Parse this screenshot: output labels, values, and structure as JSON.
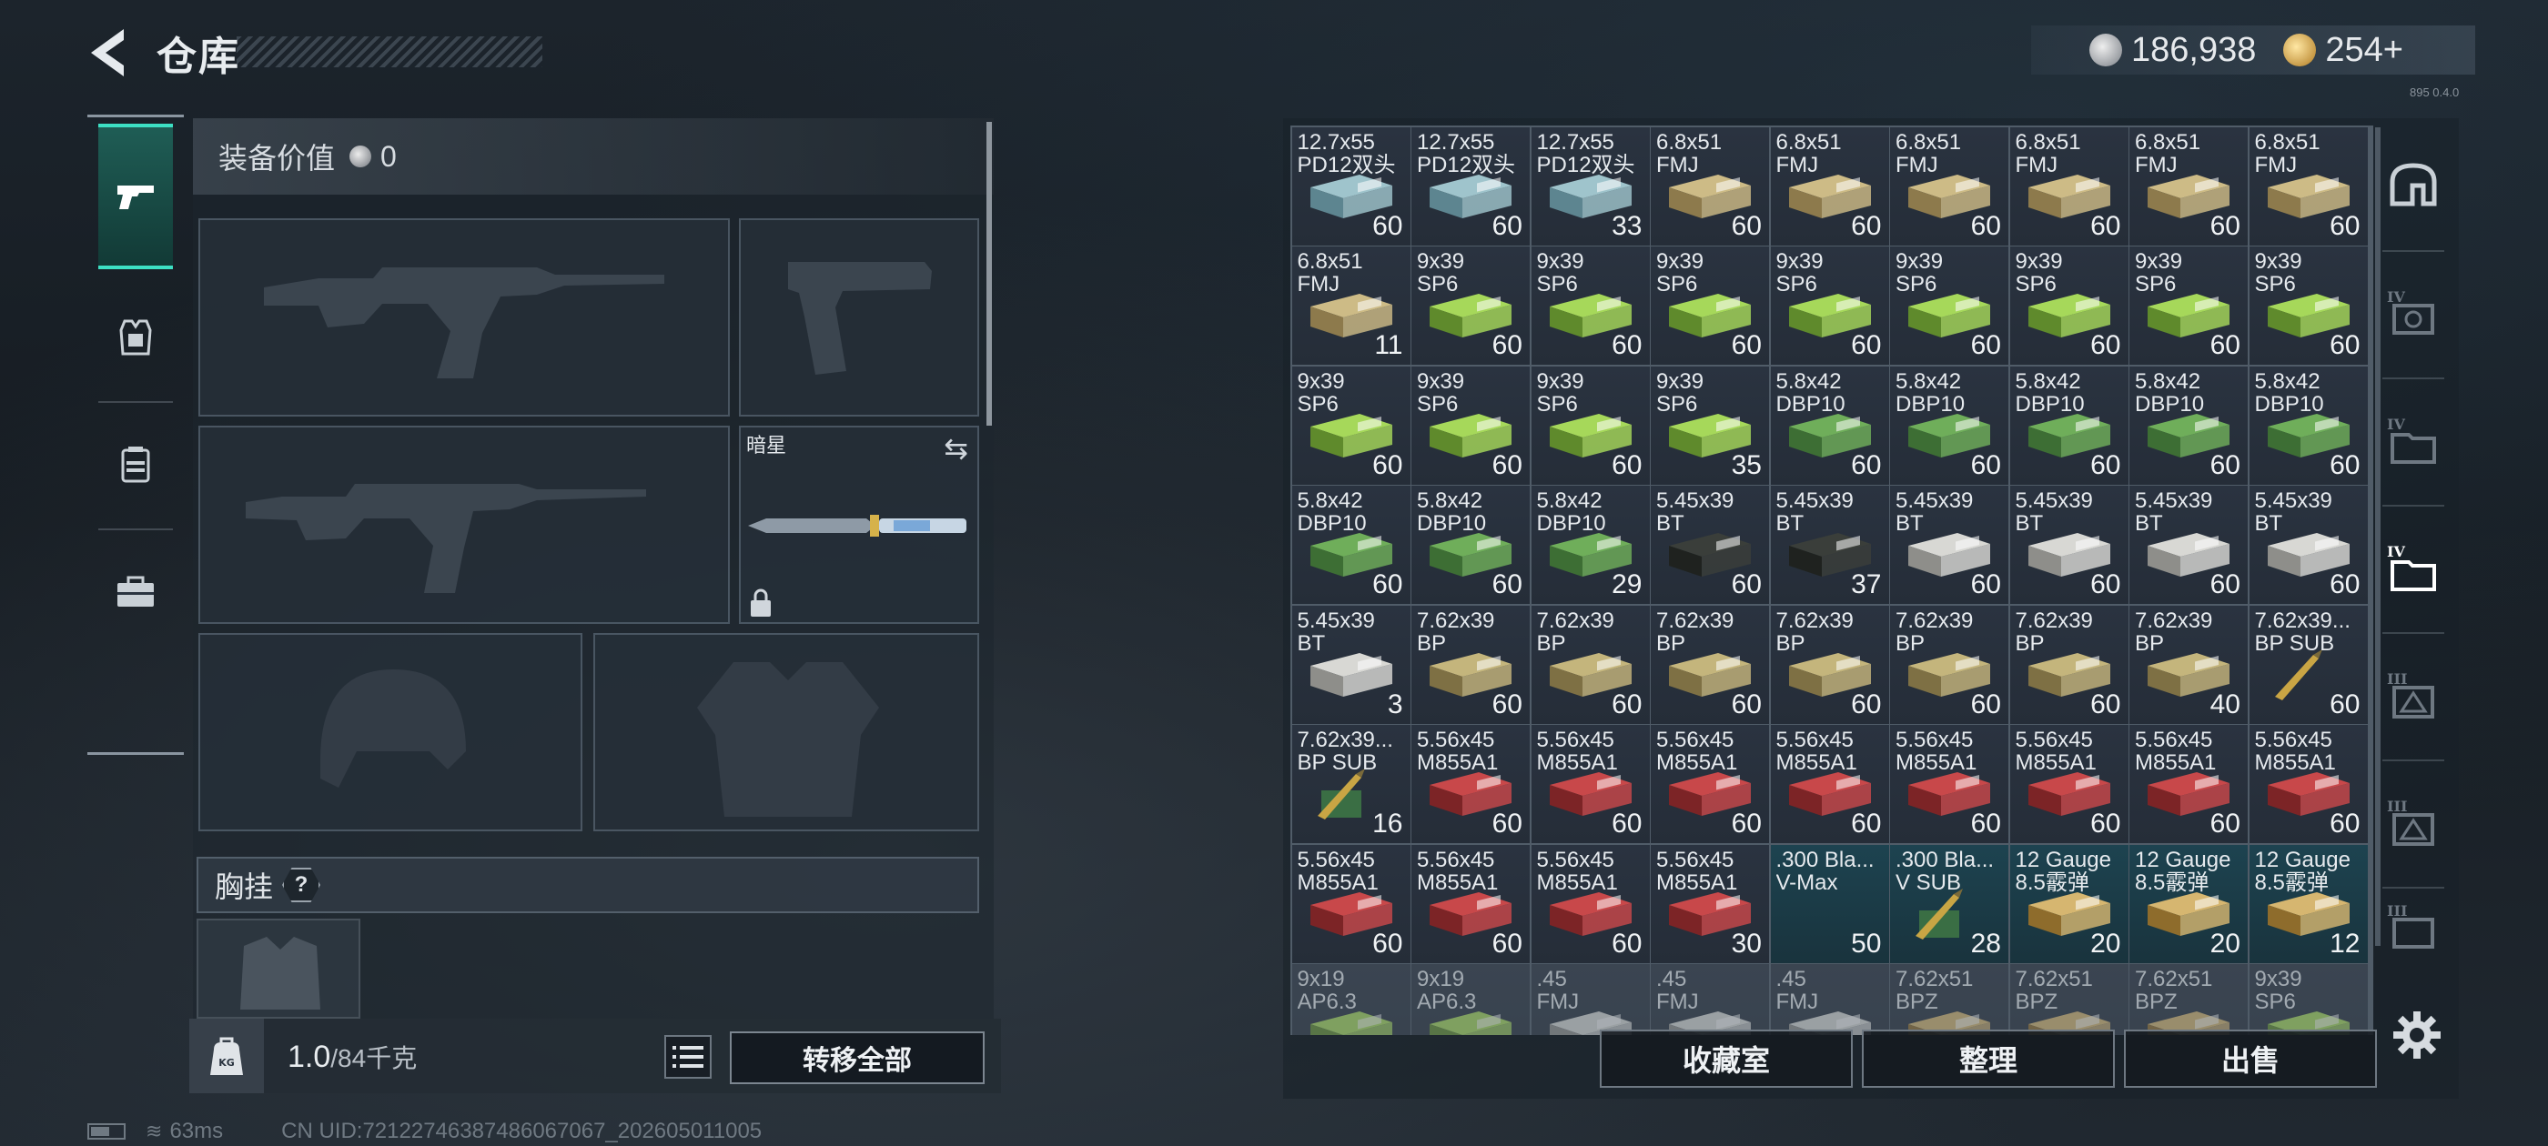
{
  "header": {
    "title": "仓库",
    "currency": {
      "silver": "186,938",
      "gold": "254+"
    },
    "version": "895 0.4.0"
  },
  "loadout": {
    "value_label": "装备价值",
    "value": "0",
    "melee_name": "暗星",
    "chest_rig_label": "胸挂",
    "chest_rig_help": "?",
    "weight_current": "1.0",
    "weight_max": "/84千克",
    "transfer_all": "转移全部"
  },
  "stash": {
    "items": [
      {
        "name": "12.7x55\nPD12双头",
        "count": "60",
        "box": "blue"
      },
      {
        "name": "12.7x55\nPD12双头",
        "count": "60",
        "box": "blue"
      },
      {
        "name": "12.7x55\nPD12双头",
        "count": "33",
        "box": "blue"
      },
      {
        "name": "6.8x51\nFMJ",
        "count": "60",
        "box": "tan"
      },
      {
        "name": "6.8x51\nFMJ",
        "count": "60",
        "box": "tan"
      },
      {
        "name": "6.8x51\nFMJ",
        "count": "60",
        "box": "tan"
      },
      {
        "name": "6.8x51\nFMJ",
        "count": "60",
        "box": "tan"
      },
      {
        "name": "6.8x51\nFMJ",
        "count": "60",
        "box": "tan"
      },
      {
        "name": "6.8x51\nFMJ",
        "count": "60",
        "box": "tan"
      },
      {
        "name": "6.8x51\nFMJ",
        "count": "11",
        "box": "tan"
      },
      {
        "name": "9x39\nSP6",
        "count": "60",
        "box": "lime"
      },
      {
        "name": "9x39\nSP6",
        "count": "60",
        "box": "lime"
      },
      {
        "name": "9x39\nSP6",
        "count": "60",
        "box": "lime"
      },
      {
        "name": "9x39\nSP6",
        "count": "60",
        "box": "lime"
      },
      {
        "name": "9x39\nSP6",
        "count": "60",
        "box": "lime"
      },
      {
        "name": "9x39\nSP6",
        "count": "60",
        "box": "lime"
      },
      {
        "name": "9x39\nSP6",
        "count": "60",
        "box": "lime"
      },
      {
        "name": "9x39\nSP6",
        "count": "60",
        "box": "lime"
      },
      {
        "name": "9x39\nSP6",
        "count": "60",
        "box": "lime"
      },
      {
        "name": "9x39\nSP6",
        "count": "60",
        "box": "lime"
      },
      {
        "name": "9x39\nSP6",
        "count": "60",
        "box": "lime"
      },
      {
        "name": "9x39\nSP6",
        "count": "35",
        "box": "lime"
      },
      {
        "name": "5.8x42\nDBP10",
        "count": "60",
        "box": "green"
      },
      {
        "name": "5.8x42\nDBP10",
        "count": "60",
        "box": "green"
      },
      {
        "name": "5.8x42\nDBP10",
        "count": "60",
        "box": "green"
      },
      {
        "name": "5.8x42\nDBP10",
        "count": "60",
        "box": "green"
      },
      {
        "name": "5.8x42\nDBP10",
        "count": "60",
        "box": "green"
      },
      {
        "name": "5.8x42\nDBP10",
        "count": "60",
        "box": "green"
      },
      {
        "name": "5.8x42\nDBP10",
        "count": "60",
        "box": "green"
      },
      {
        "name": "5.8x42\nDBP10",
        "count": "29",
        "box": "green"
      },
      {
        "name": "5.45x39\nBT",
        "count": "60",
        "box": "dark"
      },
      {
        "name": "5.45x39\nBT",
        "count": "37",
        "box": "dark"
      },
      {
        "name": "5.45x39\nBT",
        "count": "60",
        "box": "white"
      },
      {
        "name": "5.45x39\nBT",
        "count": "60",
        "box": "white"
      },
      {
        "name": "5.45x39\nBT",
        "count": "60",
        "box": "white"
      },
      {
        "name": "5.45x39\nBT",
        "count": "60",
        "box": "white"
      },
      {
        "name": "5.45x39\nBT",
        "count": "3",
        "box": "white"
      },
      {
        "name": "7.62x39\nBP",
        "count": "60",
        "box": "khaki"
      },
      {
        "name": "7.62x39\nBP",
        "count": "60",
        "box": "khaki"
      },
      {
        "name": "7.62x39\nBP",
        "count": "60",
        "box": "khaki"
      },
      {
        "name": "7.62x39\nBP",
        "count": "60",
        "box": "khaki"
      },
      {
        "name": "7.62x39\nBP",
        "count": "60",
        "box": "khaki"
      },
      {
        "name": "7.62x39\nBP",
        "count": "60",
        "box": "khaki"
      },
      {
        "name": "7.62x39\nBP",
        "count": "40",
        "box": "khaki"
      },
      {
        "name": "7.62x39...\nBP SUB",
        "count": "60",
        "box": "bullet"
      },
      {
        "name": "7.62x39...\nBP SUB",
        "count": "16",
        "box": "bulletgreen"
      },
      {
        "name": "5.56x45\nM855A1",
        "count": "60",
        "box": "red"
      },
      {
        "name": "5.56x45\nM855A1",
        "count": "60",
        "box": "red"
      },
      {
        "name": "5.56x45\nM855A1",
        "count": "60",
        "box": "red"
      },
      {
        "name": "5.56x45\nM855A1",
        "count": "60",
        "box": "red"
      },
      {
        "name": "5.56x45\nM855A1",
        "count": "60",
        "box": "red"
      },
      {
        "name": "5.56x45\nM855A1",
        "count": "60",
        "box": "red"
      },
      {
        "name": "5.56x45\nM855A1",
        "count": "60",
        "box": "red"
      },
      {
        "name": "5.56x45\nM855A1",
        "count": "60",
        "box": "red"
      },
      {
        "name": "5.56x45\nM855A1",
        "count": "60",
        "box": "red"
      },
      {
        "name": "5.56x45\nM855A1",
        "count": "60",
        "box": "red"
      },
      {
        "name": "5.56x45\nM855A1",
        "count": "60",
        "box": "red"
      },
      {
        "name": "5.56x45\nM855A1",
        "count": "30",
        "box": "red"
      },
      {
        "name": ".300 Bla...\nV-Max",
        "count": "50",
        "box": "none",
        "teal": true
      },
      {
        "name": ".300 Bla...\nV SUB",
        "count": "28",
        "box": "bulletgreen",
        "teal": true
      },
      {
        "name": "12 Gauge\n8.5霰弹",
        "count": "20",
        "box": "gauge",
        "teal": true
      },
      {
        "name": "12 Gauge\n8.5霰弹",
        "count": "20",
        "box": "gauge",
        "teal": true
      },
      {
        "name": "12 Gauge\n8.5霰弹",
        "count": "12",
        "box": "gauge",
        "teal": true
      },
      {
        "name": "9x19\nAP6.3",
        "count": "",
        "box": "lime",
        "dim": true
      },
      {
        "name": "9x19\nAP6.3",
        "count": "",
        "box": "lime",
        "dim": true
      },
      {
        "name": ".45\nFMJ",
        "count": "",
        "box": "white",
        "dim": true
      },
      {
        "name": ".45\nFMJ",
        "count": "",
        "box": "white",
        "dim": true
      },
      {
        "name": ".45\nFMJ",
        "count": "",
        "box": "white",
        "dim": true
      },
      {
        "name": "7.62x51\nBPZ",
        "count": "",
        "box": "gauge",
        "dim": true
      },
      {
        "name": "7.62x51\nBPZ",
        "count": "",
        "box": "gauge",
        "dim": true
      },
      {
        "name": "7.62x51\nBPZ",
        "count": "",
        "box": "gauge",
        "dim": true
      },
      {
        "name": "9x39\nSP6",
        "count": "",
        "box": "lime",
        "dim": true
      }
    ],
    "buttons": {
      "collection": "收藏室",
      "sort": "整理",
      "sell": "出售"
    }
  },
  "status": {
    "ping": "63ms",
    "uid": "CN UID:72122746387486067067_202605011005"
  },
  "colors": {
    "accent": "#3de0c4",
    "panel": "#26303a",
    "tealCell": "#1d4350"
  },
  "box_colors": {
    "blue": [
      "#9fc4cc",
      "#5d8590"
    ],
    "tan": [
      "#cdbb86",
      "#8d7a4c"
    ],
    "lime": [
      "#a6d85a",
      "#5f8a2c"
    ],
    "green": [
      "#6fae5a",
      "#3d6e34"
    ],
    "white": [
      "#d8d8d4",
      "#8e8e8a"
    ],
    "khaki": [
      "#c4b57c",
      "#7e7044"
    ],
    "red": [
      "#c8484a",
      "#7c2426"
    ],
    "gauge": [
      "#d6b670",
      "#8e6c2c"
    ],
    "dark": [
      "#3a3e3a",
      "#1f221f"
    ]
  }
}
